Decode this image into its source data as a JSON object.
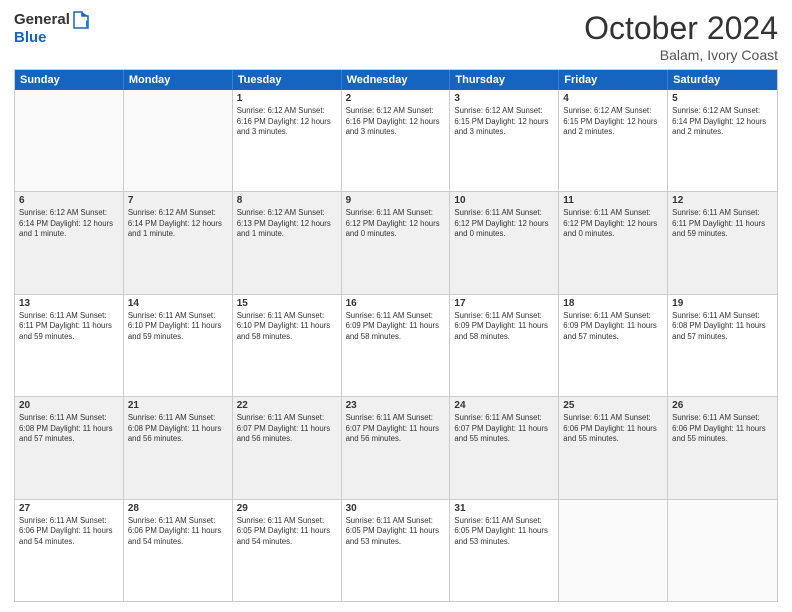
{
  "header": {
    "logo_general": "General",
    "logo_blue": "Blue",
    "month_title": "October 2024",
    "location": "Balam, Ivory Coast"
  },
  "days_of_week": [
    "Sunday",
    "Monday",
    "Tuesday",
    "Wednesday",
    "Thursday",
    "Friday",
    "Saturday"
  ],
  "weeks": [
    [
      {
        "day": "",
        "detail": "",
        "shaded": false,
        "empty": true
      },
      {
        "day": "",
        "detail": "",
        "shaded": false,
        "empty": true
      },
      {
        "day": "1",
        "detail": "Sunrise: 6:12 AM\nSunset: 6:16 PM\nDaylight: 12 hours and 3 minutes.",
        "shaded": false
      },
      {
        "day": "2",
        "detail": "Sunrise: 6:12 AM\nSunset: 6:16 PM\nDaylight: 12 hours and 3 minutes.",
        "shaded": false
      },
      {
        "day": "3",
        "detail": "Sunrise: 6:12 AM\nSunset: 6:15 PM\nDaylight: 12 hours and 3 minutes.",
        "shaded": false
      },
      {
        "day": "4",
        "detail": "Sunrise: 6:12 AM\nSunset: 6:15 PM\nDaylight: 12 hours and 2 minutes.",
        "shaded": false
      },
      {
        "day": "5",
        "detail": "Sunrise: 6:12 AM\nSunset: 6:14 PM\nDaylight: 12 hours and 2 minutes.",
        "shaded": false
      }
    ],
    [
      {
        "day": "6",
        "detail": "Sunrise: 6:12 AM\nSunset: 6:14 PM\nDaylight: 12 hours and 1 minute.",
        "shaded": true
      },
      {
        "day": "7",
        "detail": "Sunrise: 6:12 AM\nSunset: 6:14 PM\nDaylight: 12 hours and 1 minute.",
        "shaded": true
      },
      {
        "day": "8",
        "detail": "Sunrise: 6:12 AM\nSunset: 6:13 PM\nDaylight: 12 hours and 1 minute.",
        "shaded": true
      },
      {
        "day": "9",
        "detail": "Sunrise: 6:11 AM\nSunset: 6:12 PM\nDaylight: 12 hours and 0 minutes.",
        "shaded": true
      },
      {
        "day": "10",
        "detail": "Sunrise: 6:11 AM\nSunset: 6:12 PM\nDaylight: 12 hours and 0 minutes.",
        "shaded": true
      },
      {
        "day": "11",
        "detail": "Sunrise: 6:11 AM\nSunset: 6:12 PM\nDaylight: 12 hours and 0 minutes.",
        "shaded": true
      },
      {
        "day": "12",
        "detail": "Sunrise: 6:11 AM\nSunset: 6:11 PM\nDaylight: 11 hours and 59 minutes.",
        "shaded": true
      }
    ],
    [
      {
        "day": "13",
        "detail": "Sunrise: 6:11 AM\nSunset: 6:11 PM\nDaylight: 11 hours and 59 minutes.",
        "shaded": false
      },
      {
        "day": "14",
        "detail": "Sunrise: 6:11 AM\nSunset: 6:10 PM\nDaylight: 11 hours and 59 minutes.",
        "shaded": false
      },
      {
        "day": "15",
        "detail": "Sunrise: 6:11 AM\nSunset: 6:10 PM\nDaylight: 11 hours and 58 minutes.",
        "shaded": false
      },
      {
        "day": "16",
        "detail": "Sunrise: 6:11 AM\nSunset: 6:09 PM\nDaylight: 11 hours and 58 minutes.",
        "shaded": false
      },
      {
        "day": "17",
        "detail": "Sunrise: 6:11 AM\nSunset: 6:09 PM\nDaylight: 11 hours and 58 minutes.",
        "shaded": false
      },
      {
        "day": "18",
        "detail": "Sunrise: 6:11 AM\nSunset: 6:09 PM\nDaylight: 11 hours and 57 minutes.",
        "shaded": false
      },
      {
        "day": "19",
        "detail": "Sunrise: 6:11 AM\nSunset: 6:08 PM\nDaylight: 11 hours and 57 minutes.",
        "shaded": false
      }
    ],
    [
      {
        "day": "20",
        "detail": "Sunrise: 6:11 AM\nSunset: 6:08 PM\nDaylight: 11 hours and 57 minutes.",
        "shaded": true
      },
      {
        "day": "21",
        "detail": "Sunrise: 6:11 AM\nSunset: 6:08 PM\nDaylight: 11 hours and 56 minutes.",
        "shaded": true
      },
      {
        "day": "22",
        "detail": "Sunrise: 6:11 AM\nSunset: 6:07 PM\nDaylight: 11 hours and 56 minutes.",
        "shaded": true
      },
      {
        "day": "23",
        "detail": "Sunrise: 6:11 AM\nSunset: 6:07 PM\nDaylight: 11 hours and 56 minutes.",
        "shaded": true
      },
      {
        "day": "24",
        "detail": "Sunrise: 6:11 AM\nSunset: 6:07 PM\nDaylight: 11 hours and 55 minutes.",
        "shaded": true
      },
      {
        "day": "25",
        "detail": "Sunrise: 6:11 AM\nSunset: 6:06 PM\nDaylight: 11 hours and 55 minutes.",
        "shaded": true
      },
      {
        "day": "26",
        "detail": "Sunrise: 6:11 AM\nSunset: 6:06 PM\nDaylight: 11 hours and 55 minutes.",
        "shaded": true
      }
    ],
    [
      {
        "day": "27",
        "detail": "Sunrise: 6:11 AM\nSunset: 6:06 PM\nDaylight: 11 hours and 54 minutes.",
        "shaded": false
      },
      {
        "day": "28",
        "detail": "Sunrise: 6:11 AM\nSunset: 6:06 PM\nDaylight: 11 hours and 54 minutes.",
        "shaded": false
      },
      {
        "day": "29",
        "detail": "Sunrise: 6:11 AM\nSunset: 6:05 PM\nDaylight: 11 hours and 54 minutes.",
        "shaded": false
      },
      {
        "day": "30",
        "detail": "Sunrise: 6:11 AM\nSunset: 6:05 PM\nDaylight: 11 hours and 53 minutes.",
        "shaded": false
      },
      {
        "day": "31",
        "detail": "Sunrise: 6:11 AM\nSunset: 6:05 PM\nDaylight: 11 hours and 53 minutes.",
        "shaded": false
      },
      {
        "day": "",
        "detail": "",
        "shaded": false,
        "empty": true
      },
      {
        "day": "",
        "detail": "",
        "shaded": false,
        "empty": true
      }
    ]
  ]
}
